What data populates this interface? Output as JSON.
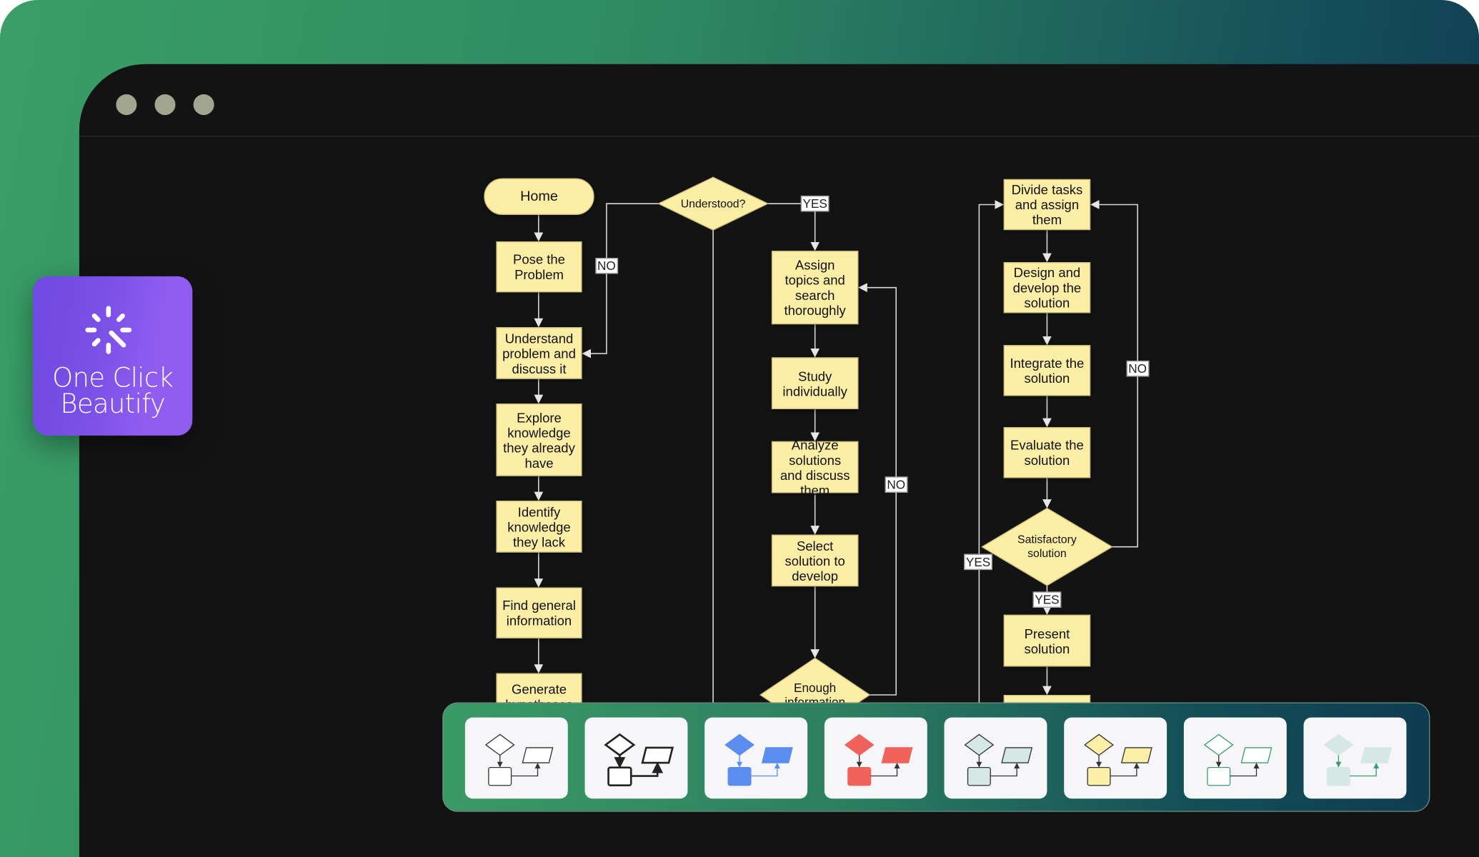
{
  "window": {
    "controls": [
      "close",
      "minimize",
      "maximize"
    ]
  },
  "badge": {
    "icon": "magic-wand-sparkle-icon",
    "line1": "One Click",
    "line2": "Beautify",
    "gradient": [
      "#7049e2",
      "#915df0"
    ]
  },
  "flowchart": {
    "node_fill": "#fdeea6",
    "col1": [
      "Home",
      "Pose the Problem",
      "Understand problem and discuss it",
      "Explore knowledge they already have",
      "Identify knowledge they lack",
      "Find general information",
      "Generate hypotheses"
    ],
    "understood": "Understood?",
    "col2": [
      "Assign topics and search thoroughly",
      "Study individually",
      "Analyze solutions and discuss them",
      "Select solution to develop"
    ],
    "enough": "Enough information",
    "col3": [
      "Divide tasks and assign them",
      "Design and develop the solution",
      "Integrate the solution",
      "Evaluate the solution"
    ],
    "satisfactory": "Satisfactory solution",
    "present": "Present solution",
    "labels": {
      "no": "NO",
      "yes": "YES"
    }
  },
  "themes": [
    {
      "name": "outline-thin",
      "fill": "#ffffff",
      "stroke": "#333333",
      "line": "#333333",
      "width": 1
    },
    {
      "name": "outline-bold",
      "fill": "#ffffff",
      "stroke": "#222222",
      "line": "#222222",
      "width": 2
    },
    {
      "name": "blue",
      "fill": "#5b8def",
      "stroke": "#5b8def",
      "line": "#5b8def",
      "width": 1
    },
    {
      "name": "red",
      "fill": "#f0635a",
      "stroke": "#f0635a",
      "line": "#333333",
      "width": 1
    },
    {
      "name": "light-teal",
      "fill": "#d6e8e6",
      "stroke": "#333333",
      "line": "#333333",
      "width": 1
    },
    {
      "name": "yellow",
      "fill": "#fdf0a6",
      "stroke": "#333333",
      "line": "#333333",
      "width": 1
    },
    {
      "name": "green-outline",
      "fill": "#ffffff",
      "stroke": "#3a9e6a",
      "line": "#333333",
      "width": 1
    },
    {
      "name": "pale-teal",
      "fill": "#d6e8e6",
      "stroke": "#d6e8e6",
      "line": "#3a9e6a",
      "width": 1
    }
  ]
}
